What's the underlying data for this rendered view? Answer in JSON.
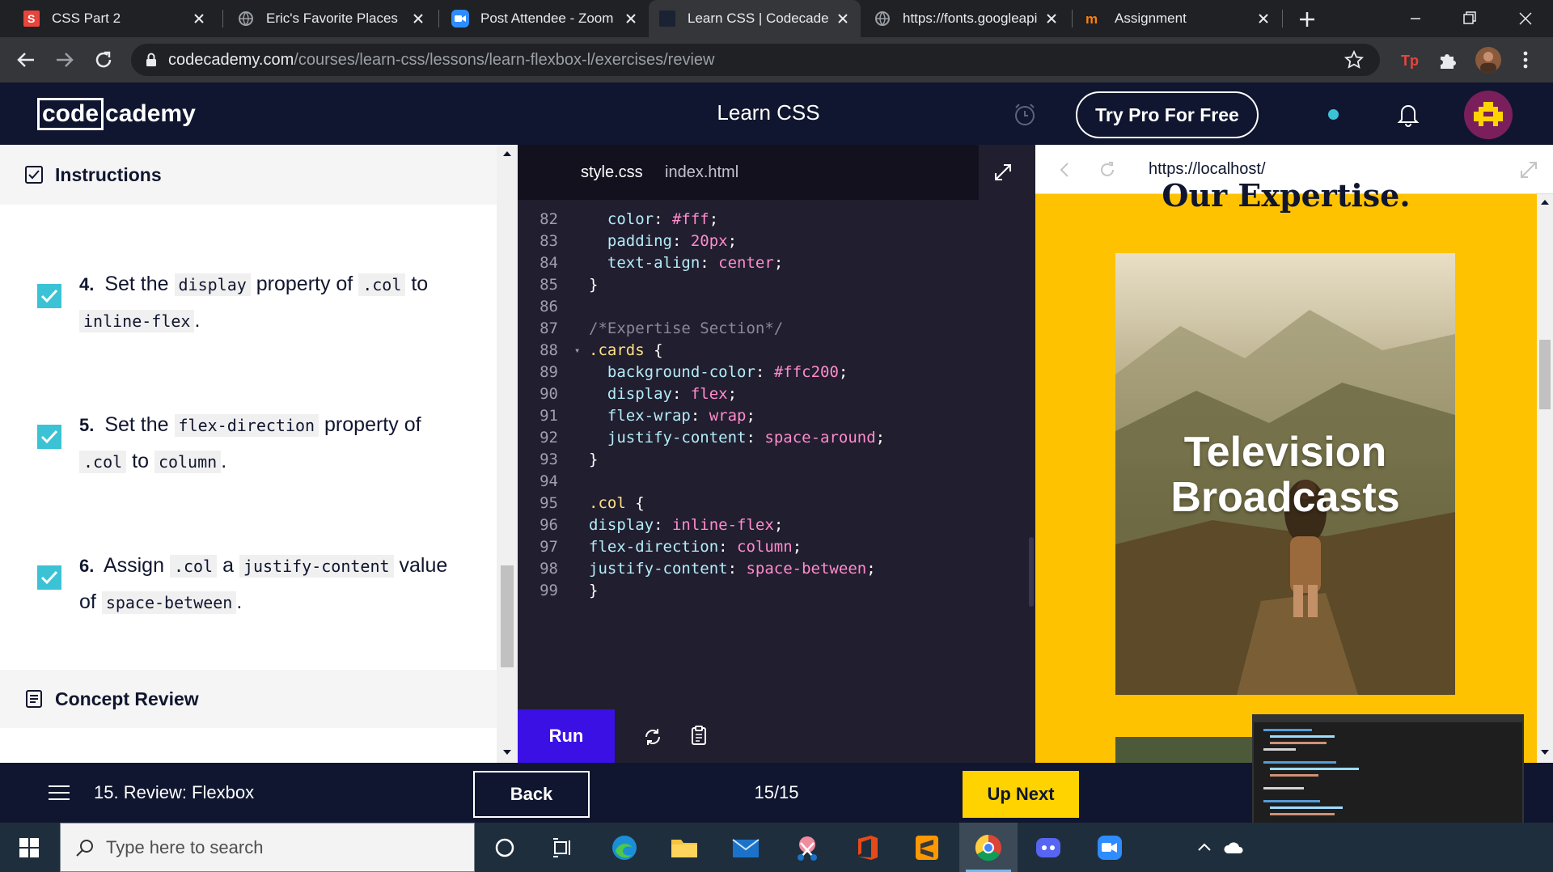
{
  "browser": {
    "tabs": [
      {
        "title": "CSS Part 2",
        "favicon": "s-icon",
        "active": false
      },
      {
        "title": "Eric's Favorite Places",
        "favicon": "globe-icon",
        "active": false
      },
      {
        "title": "Post Attendee - Zoom",
        "favicon": "zoom-icon",
        "active": false
      },
      {
        "title": "Learn CSS | Codecademy",
        "favicon": "codecademy-icon",
        "active": true
      },
      {
        "title": "https://fonts.googleapis.com",
        "favicon": "globe-icon",
        "active": false
      },
      {
        "title": "Assignment",
        "favicon": "moodle-icon",
        "active": false
      }
    ],
    "url_host": "codecademy.com",
    "url_path": "/courses/learn-css/lessons/learn-flexbox-l/exercises/review"
  },
  "header": {
    "logo_left": "code",
    "logo_right": "cademy",
    "title": "Learn CSS",
    "pro_button": "Try Pro For Free"
  },
  "instructions": {
    "heading": "Instructions",
    "steps": [
      {
        "num": "4.",
        "t1": "Set the",
        "c1": "display",
        "t2": "property of",
        "c2": ".col",
        "t3": "to",
        "c3": "inline-flex",
        "t4": "."
      },
      {
        "num": "5.",
        "t1": "Set the",
        "c1": "flex-direction",
        "t2": "property of",
        "c2": ".col",
        "t3": "to",
        "c3": "column",
        "t4": "."
      },
      {
        "num": "6.",
        "t1": "Assign",
        "c1": ".col",
        "t2": "a",
        "c2": "justify-content",
        "t3": "value of",
        "c3": "space-between",
        "t4": "."
      }
    ],
    "concept_review": "Concept Review"
  },
  "editor": {
    "tabs": [
      "style.css",
      "index.html"
    ],
    "active_tab": "style.css",
    "lines": [
      {
        "n": "82",
        "indent": 2,
        "parts": [
          [
            "prop",
            "color"
          ],
          [
            "pun",
            ": "
          ],
          [
            "hex",
            "#fff"
          ],
          [
            "pun",
            ";"
          ]
        ]
      },
      {
        "n": "83",
        "indent": 2,
        "parts": [
          [
            "prop",
            "padding"
          ],
          [
            "pun",
            ": "
          ],
          [
            "val",
            "20px"
          ],
          [
            "pun",
            ";"
          ]
        ]
      },
      {
        "n": "84",
        "indent": 2,
        "parts": [
          [
            "prop",
            "text-align"
          ],
          [
            "pun",
            ": "
          ],
          [
            "val",
            "center"
          ],
          [
            "pun",
            ";"
          ]
        ]
      },
      {
        "n": "85",
        "indent": 1,
        "parts": [
          [
            "pun",
            "}"
          ]
        ]
      },
      {
        "n": "86",
        "indent": 0,
        "parts": []
      },
      {
        "n": "87",
        "indent": 1,
        "parts": [
          [
            "com",
            "/*Expertise Section*/"
          ]
        ]
      },
      {
        "n": "88",
        "indent": 1,
        "fold": true,
        "parts": [
          [
            "sel",
            ".cards"
          ],
          [
            "pun",
            " {"
          ]
        ]
      },
      {
        "n": "89",
        "indent": 2,
        "parts": [
          [
            "prop",
            "background-color"
          ],
          [
            "pun",
            ": "
          ],
          [
            "hex",
            "#ffc200"
          ],
          [
            "pun",
            ";"
          ]
        ]
      },
      {
        "n": "90",
        "indent": 2,
        "parts": [
          [
            "prop",
            "display"
          ],
          [
            "pun",
            ": "
          ],
          [
            "val",
            "flex"
          ],
          [
            "pun",
            ";"
          ]
        ]
      },
      {
        "n": "91",
        "indent": 2,
        "parts": [
          [
            "prop",
            "flex-wrap"
          ],
          [
            "pun",
            ": "
          ],
          [
            "val",
            "wrap"
          ],
          [
            "pun",
            ";"
          ]
        ]
      },
      {
        "n": "92",
        "indent": 2,
        "parts": [
          [
            "prop",
            "justify-content"
          ],
          [
            "pun",
            ": "
          ],
          [
            "val",
            "space-around"
          ],
          [
            "pun",
            ";"
          ]
        ]
      },
      {
        "n": "93",
        "indent": 1,
        "parts": [
          [
            "pun",
            "}"
          ]
        ]
      },
      {
        "n": "94",
        "indent": 0,
        "parts": []
      },
      {
        "n": "95",
        "indent": 1,
        "parts": [
          [
            "sel",
            ".col"
          ],
          [
            "pun",
            " {"
          ]
        ]
      },
      {
        "n": "96",
        "indent": 1,
        "parts": [
          [
            "prop",
            "display"
          ],
          [
            "pun",
            ": "
          ],
          [
            "val",
            "inline-flex"
          ],
          [
            "pun",
            ";"
          ]
        ]
      },
      {
        "n": "97",
        "indent": 1,
        "parts": [
          [
            "prop",
            "flex-direction"
          ],
          [
            "pun",
            ": "
          ],
          [
            "val",
            "column"
          ],
          [
            "pun",
            ";"
          ]
        ]
      },
      {
        "n": "98",
        "indent": 1,
        "parts": [
          [
            "prop",
            "justify-content"
          ],
          [
            "pun",
            ": "
          ],
          [
            "val",
            "space-between"
          ],
          [
            "pun",
            ";"
          ]
        ]
      },
      {
        "n": "99",
        "indent": 1,
        "parts": [
          [
            "pun",
            "}"
          ]
        ]
      }
    ],
    "run_label": "Run"
  },
  "preview": {
    "url": "https://localhost/",
    "section_title": "Our Expertise.",
    "card_title_line1": "Television",
    "card_title_line2": "Broadcasts"
  },
  "footer": {
    "lesson": "15. Review: Flexbox",
    "back": "Back",
    "progress": "15/15",
    "next": "Up Next"
  },
  "taskbar": {
    "search_placeholder": "Type here to search"
  },
  "colors": {
    "codecademy_navy": "#10162f",
    "accent_yellow": "#ffd300",
    "card_bg": "#ffc200",
    "run_blue": "#3a10e5",
    "check_teal": "#3bc3d5"
  }
}
